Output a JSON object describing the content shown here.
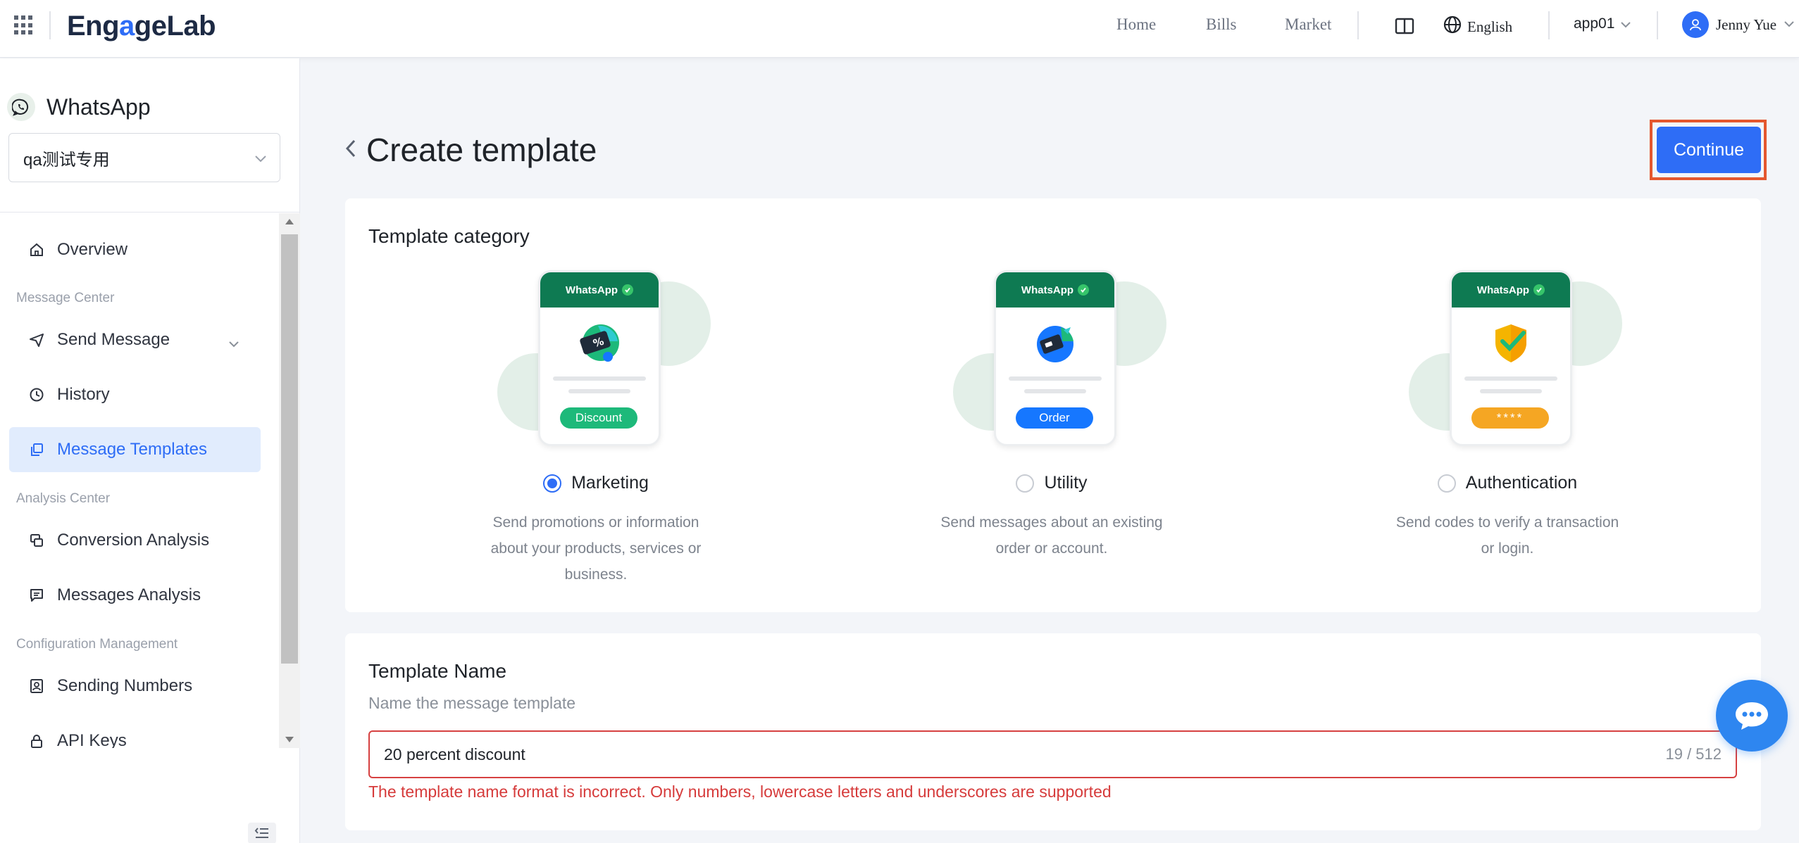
{
  "topbar": {
    "logo": {
      "part1": "Eng",
      "part2": "a",
      "part3": "geLab"
    },
    "nav": [
      "Home",
      "Bills",
      "Market"
    ],
    "language": "English",
    "app": "app01",
    "user": "Jenny Yue"
  },
  "sidebar": {
    "product": "WhatsApp",
    "project": "qa测试专用",
    "groups": {
      "message_center": "Message Center",
      "analysis_center": "Analysis Center",
      "config": "Configuration Management"
    },
    "items": {
      "overview": "Overview",
      "send_message": "Send Message",
      "history": "History",
      "templates": "Message Templates",
      "conversion": "Conversion Analysis",
      "messages_analysis": "Messages Analysis",
      "sending_numbers": "Sending Numbers",
      "api_keys": "API Keys"
    }
  },
  "page": {
    "title": "Create template",
    "continue": "Continue"
  },
  "category": {
    "title": "Template category",
    "options": [
      {
        "label": "Marketing",
        "selected": true,
        "badge": "Discount",
        "badge_color": "#1db97a",
        "phone_title": "WhatsApp",
        "desc_lines": [
          "Send promotions or information",
          "about your products, services or",
          "business."
        ]
      },
      {
        "label": "Utility",
        "selected": false,
        "badge": "Order",
        "badge_color": "#1677ff",
        "phone_title": "WhatsApp",
        "desc_lines": [
          "Send messages about an existing",
          "order or account."
        ]
      },
      {
        "label": "Authentication",
        "selected": false,
        "badge": "****",
        "badge_color": "#f5a623",
        "phone_title": "WhatsApp",
        "desc_lines": [
          "Send codes to verify a transaction",
          "or login."
        ]
      }
    ]
  },
  "template_name": {
    "title": "Template Name",
    "subtitle": "Name the message template",
    "value": "20 percent discount",
    "count": "19 / 512",
    "error": "The template name format is incorrect. Only numbers, lowercase letters and underscores are supported"
  },
  "colors": {
    "primary": "#2e6df6",
    "whatsapp_green": "#0e7a52",
    "error": "#d64141",
    "highlight_frame": "#e4572e"
  },
  "icons": [
    "apps-grid-icon",
    "book-icon",
    "globe-icon",
    "chevron-down-icon",
    "user-icon",
    "whatsapp-icon",
    "home-icon",
    "send-icon",
    "history-icon",
    "templates-icon",
    "conversion-icon",
    "messages-icon",
    "contact-card-icon",
    "lock-icon",
    "chevron-left-icon",
    "chat-bubble-icon",
    "collapse-menu-icon"
  ]
}
